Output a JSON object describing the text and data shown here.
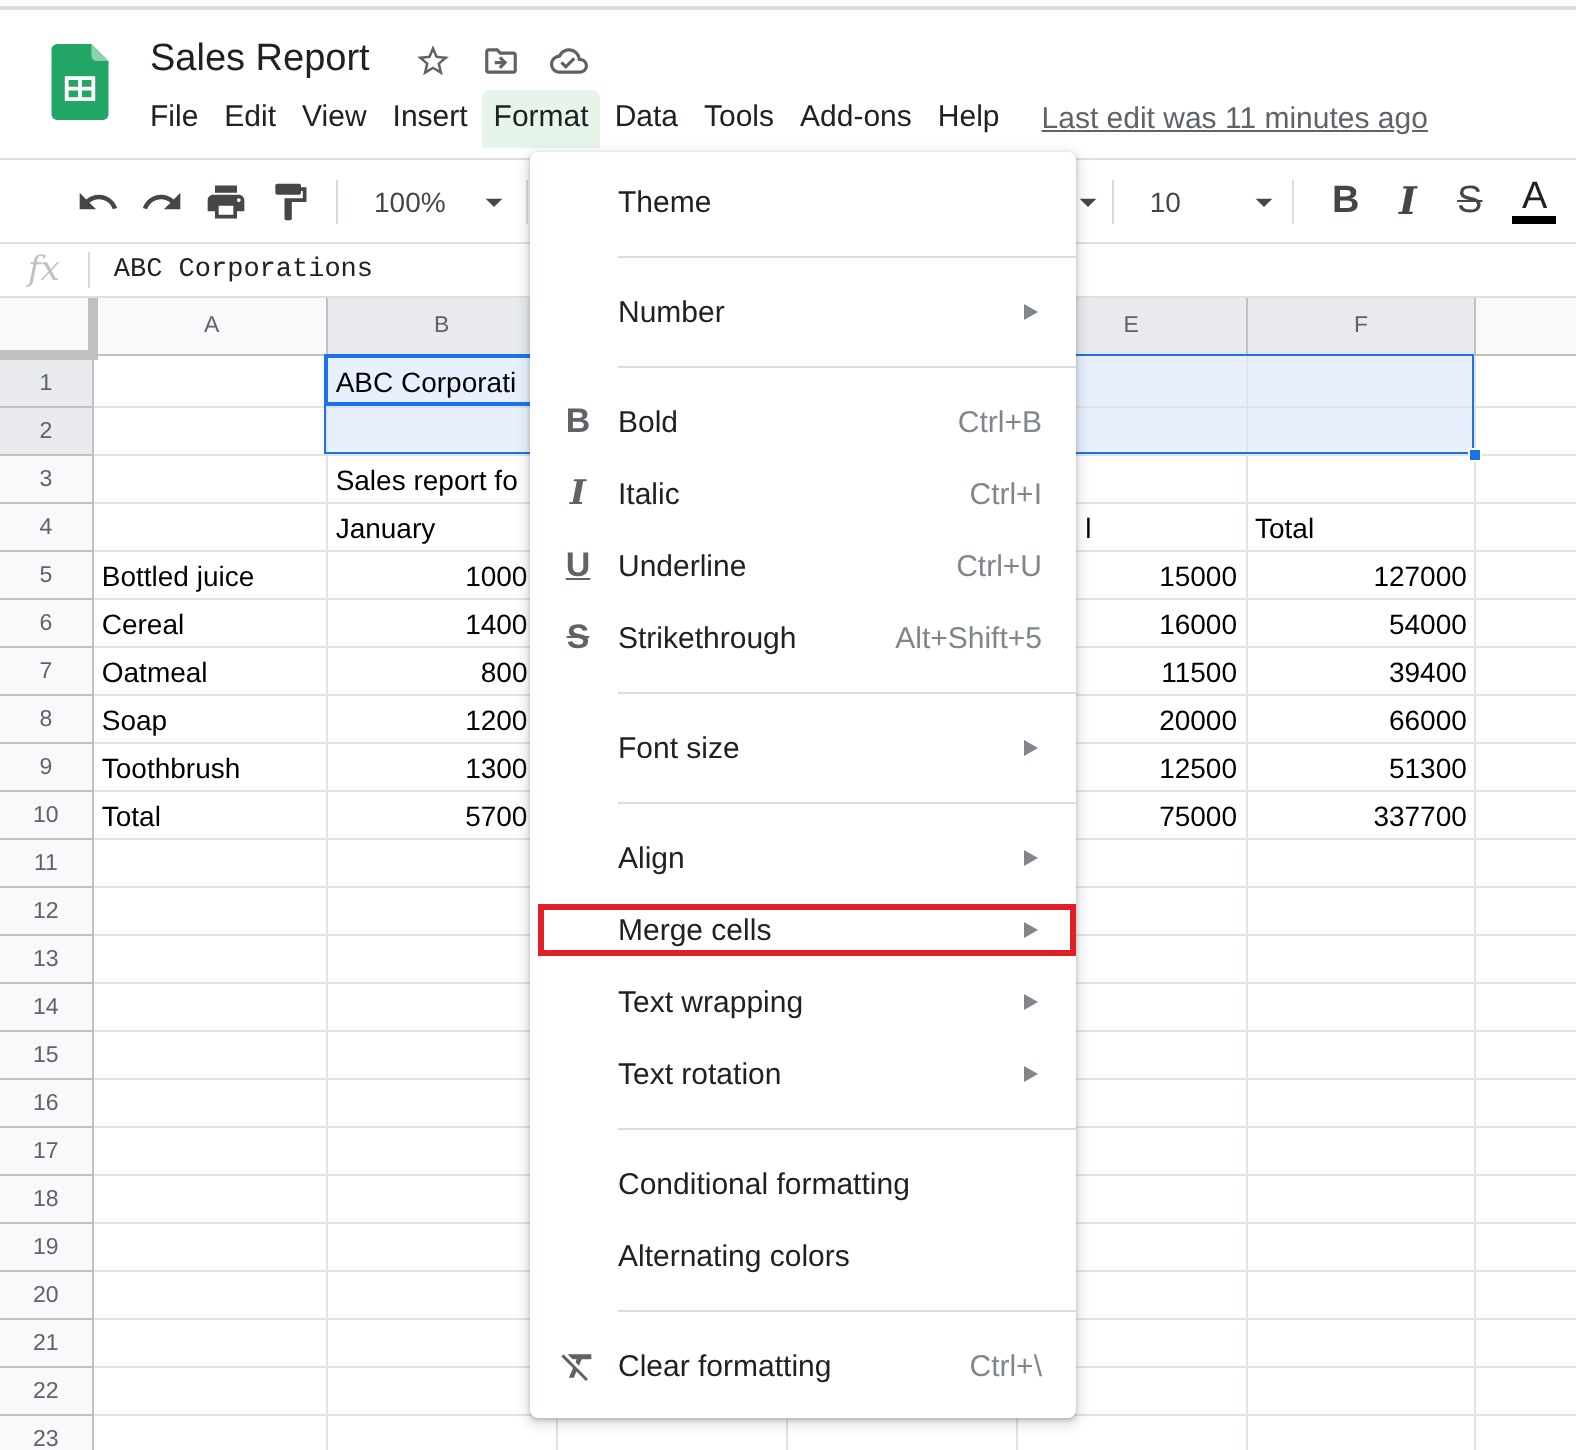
{
  "app": {
    "title": "Sales Report",
    "last_edit": "Last edit was 11 minutes ago"
  },
  "menu_bar": [
    {
      "label": "File",
      "selected": false
    },
    {
      "label": "Edit",
      "selected": false
    },
    {
      "label": "View",
      "selected": false
    },
    {
      "label": "Insert",
      "selected": false
    },
    {
      "label": "Format",
      "selected": true
    },
    {
      "label": "Data",
      "selected": false
    },
    {
      "label": "Tools",
      "selected": false
    },
    {
      "label": "Add-ons",
      "selected": false
    },
    {
      "label": "Help",
      "selected": false
    }
  ],
  "toolbar": {
    "zoom": "100%",
    "font_size": "10",
    "format_buttons": [
      {
        "glyph": "B",
        "kind": "bold"
      },
      {
        "glyph": "I",
        "kind": "italic"
      },
      {
        "glyph": "S",
        "kind": "strike"
      },
      {
        "glyph": "A",
        "kind": "color"
      }
    ]
  },
  "formula_bar": {
    "label": "fx",
    "content": "ABC Corporations"
  },
  "sheet": {
    "columns": [
      {
        "label": "A",
        "selected": false
      },
      {
        "label": "B",
        "selected": true
      },
      {
        "label": "E",
        "selected": true
      },
      {
        "label": "F",
        "selected": true
      }
    ],
    "rows": [
      {
        "label": "1",
        "selected": true,
        "cells": [
          null,
          {
            "text": "ABC Corporati",
            "kind": "text"
          },
          null,
          null
        ]
      },
      {
        "label": "2",
        "selected": true,
        "cells": [
          null,
          null,
          null,
          null
        ]
      },
      {
        "label": "3",
        "selected": false,
        "cells": [
          null,
          {
            "text": "Sales report fo",
            "kind": "text"
          },
          null,
          null
        ]
      },
      {
        "label": "4",
        "selected": false,
        "cells": [
          null,
          {
            "text": "January",
            "kind": "text"
          },
          {
            "text": "l",
            "kind": "text"
          },
          {
            "text": "Total",
            "kind": "text"
          }
        ]
      },
      {
        "label": "5",
        "selected": false,
        "cells": [
          {
            "text": "Bottled juice",
            "kind": "text"
          },
          {
            "text": "1000",
            "kind": "number"
          },
          {
            "text": "15000",
            "kind": "number"
          },
          {
            "text": "127000",
            "kind": "number"
          }
        ]
      },
      {
        "label": "6",
        "selected": false,
        "cells": [
          {
            "text": "Cereal",
            "kind": "text"
          },
          {
            "text": "1400",
            "kind": "number"
          },
          {
            "text": "16000",
            "kind": "number"
          },
          {
            "text": "54000",
            "kind": "number"
          }
        ]
      },
      {
        "label": "7",
        "selected": false,
        "cells": [
          {
            "text": "Oatmeal",
            "kind": "text"
          },
          {
            "text": "800",
            "kind": "number"
          },
          {
            "text": "11500",
            "kind": "number"
          },
          {
            "text": "39400",
            "kind": "number"
          }
        ]
      },
      {
        "label": "8",
        "selected": false,
        "cells": [
          {
            "text": "Soap",
            "kind": "text"
          },
          {
            "text": "1200",
            "kind": "number"
          },
          {
            "text": "20000",
            "kind": "number"
          },
          {
            "text": "66000",
            "kind": "number"
          }
        ]
      },
      {
        "label": "9",
        "selected": false,
        "cells": [
          {
            "text": "Toothbrush",
            "kind": "text"
          },
          {
            "text": "1300",
            "kind": "number"
          },
          {
            "text": "12500",
            "kind": "number"
          },
          {
            "text": "51300",
            "kind": "number"
          }
        ]
      },
      {
        "label": "10",
        "selected": false,
        "cells": [
          {
            "text": "Total",
            "kind": "text"
          },
          {
            "text": "5700",
            "kind": "number"
          },
          {
            "text": "75000",
            "kind": "number"
          },
          {
            "text": "337700",
            "kind": "number"
          }
        ]
      },
      {
        "label": "11",
        "selected": false
      },
      {
        "label": "12",
        "selected": false
      },
      {
        "label": "13",
        "selected": false
      },
      {
        "label": "14",
        "selected": false
      },
      {
        "label": "15",
        "selected": false
      },
      {
        "label": "16",
        "selected": false
      },
      {
        "label": "17",
        "selected": false
      },
      {
        "label": "18",
        "selected": false
      },
      {
        "label": "19",
        "selected": false
      },
      {
        "label": "20",
        "selected": false
      },
      {
        "label": "21",
        "selected": false
      },
      {
        "label": "22",
        "selected": false
      },
      {
        "label": "23",
        "selected": false
      }
    ]
  },
  "format_menu": {
    "groups": [
      [
        {
          "label": "Theme",
          "kind": "plain",
          "submenu": false,
          "outlined": false
        }
      ],
      [
        {
          "label": "Number",
          "kind": "plain",
          "submenu": true,
          "outlined": false
        }
      ],
      [
        {
          "label": "Bold",
          "kind": "bold",
          "glyph": "B",
          "shortcut": "Ctrl+B",
          "submenu": false,
          "outlined": false
        },
        {
          "label": "Italic",
          "kind": "italic",
          "glyph": "I",
          "shortcut": "Ctrl+I",
          "submenu": false,
          "outlined": false
        },
        {
          "label": "Underline",
          "kind": "underline",
          "glyph": "U",
          "shortcut": "Ctrl+U",
          "submenu": false,
          "outlined": false
        },
        {
          "label": "Strikethrough",
          "kind": "strike",
          "glyph": "S",
          "shortcut": "Alt+Shift+5",
          "submenu": false,
          "outlined": false
        }
      ],
      [
        {
          "label": "Font size",
          "kind": "plain",
          "submenu": true,
          "outlined": false
        }
      ],
      [
        {
          "label": "Align",
          "kind": "plain",
          "submenu": true,
          "outlined": false
        },
        {
          "label": "Merge cells",
          "kind": "plain",
          "submenu": true,
          "outlined": true
        },
        {
          "label": "Text wrapping",
          "kind": "plain",
          "submenu": true,
          "outlined": false
        },
        {
          "label": "Text rotation",
          "kind": "plain",
          "submenu": true,
          "outlined": false
        }
      ],
      [
        {
          "label": "Conditional formatting",
          "kind": "plain",
          "submenu": false,
          "outlined": false
        },
        {
          "label": "Alternating colors",
          "kind": "plain",
          "submenu": false,
          "outlined": false
        }
      ],
      [
        {
          "label": "Clear formatting",
          "kind": "clear",
          "shortcut": "Ctrl+\\",
          "submenu": false,
          "outlined": false
        }
      ]
    ]
  }
}
